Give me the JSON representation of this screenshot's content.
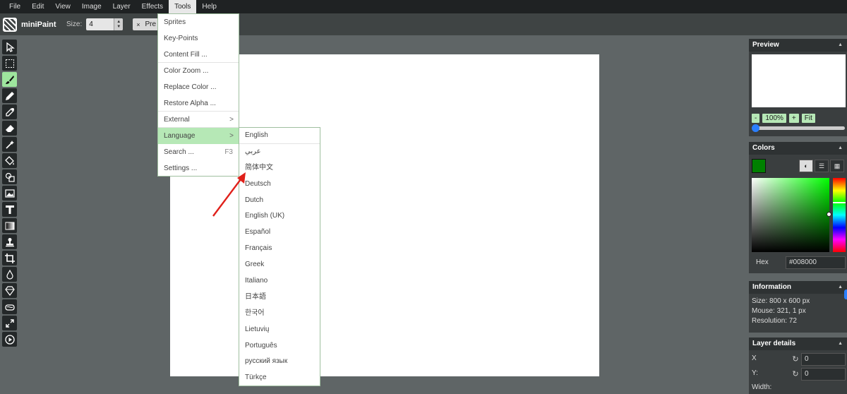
{
  "menubar": {
    "items": [
      "File",
      "Edit",
      "View",
      "Image",
      "Layer",
      "Effects",
      "Tools",
      "Help"
    ],
    "active": "Tools"
  },
  "toolbar": {
    "app_name": "miniPaint",
    "size_label": "Size:",
    "size_value": "4",
    "pre_label": "Pre",
    "pre_close": "×"
  },
  "left_tools": [
    "select-icon",
    "selection-rect-icon",
    "brush-icon",
    "pencil-icon",
    "color-picker-icon",
    "eraser-icon",
    "magic-wand-icon",
    "fill-icon",
    "shape-icon",
    "image-icon",
    "text-icon",
    "gradient-icon",
    "clone-stamp-icon",
    "crop-icon",
    "blur-icon",
    "sharpen-icon",
    "bulge-icon",
    "resize-icon",
    "play-icon"
  ],
  "selected_tool": "brush-icon",
  "tools_menu": {
    "items": [
      {
        "label": "Sprites"
      },
      {
        "label": "Key-Points"
      },
      {
        "label": "Content Fill ..."
      },
      {
        "label": "Color Zoom ..."
      },
      {
        "label": "Replace Color ..."
      },
      {
        "label": "Restore Alpha ..."
      },
      {
        "label": "External",
        "arrow": ">"
      },
      {
        "label": "Language",
        "arrow": ">"
      },
      {
        "label": "Search ...",
        "shortcut": "F3"
      },
      {
        "label": "Settings ..."
      }
    ]
  },
  "language_menu": {
    "items": [
      "English",
      "عربي",
      "简体中文",
      "Deutsch",
      "Dutch",
      "English (UK)",
      "Español",
      "Français",
      "Greek",
      "Italiano",
      "日本語",
      "한국어",
      "Lietuvių",
      "Português",
      "русский язык",
      "Türkçe"
    ]
  },
  "preview": {
    "title": "Preview",
    "caret": "▲",
    "zoom_out": "-",
    "zoom_value": "100%",
    "zoom_in": "+",
    "fit": "Fit",
    "zoom_slider_fraction": 0.0
  },
  "colors": {
    "title": "Colors",
    "caret": "▲",
    "hex_label": "Hex",
    "hex_value": "#008000",
    "swatch": "#008000"
  },
  "information": {
    "title": "Information",
    "caret": "▲",
    "size": "Size: 800 x 600 px",
    "mouse": "Mouse: 321, 1 px",
    "resolution": "Resolution: 72"
  },
  "layer_details": {
    "title": "Layer details",
    "caret": "▲",
    "x_label": "X",
    "x_value": "0",
    "y_label": "Y:",
    "y_value": "0",
    "width_label": "Width:"
  }
}
